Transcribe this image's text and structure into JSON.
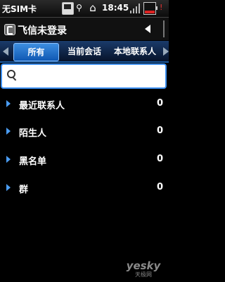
{
  "status_bar": {
    "sim_status": "无SIM卡",
    "time": "18:45",
    "icons": [
      "sd-card-icon",
      "usb-icon",
      "home-icon",
      "signal-icon",
      "battery-icon",
      "alert-icon"
    ]
  },
  "app": {
    "title": "飞信未登录"
  },
  "tabs": [
    {
      "label": "所有",
      "selected": true
    },
    {
      "label": "当前会话",
      "selected": false
    },
    {
      "label": "本地联系人",
      "selected": false
    }
  ],
  "search": {
    "value": "",
    "placeholder": ""
  },
  "groups": [
    {
      "label": "最近联系人",
      "count": "0"
    },
    {
      "label": "陌生人",
      "count": "0"
    },
    {
      "label": "黑名单",
      "count": "0"
    },
    {
      "label": "群",
      "count": "0"
    }
  ],
  "watermark": {
    "logo": "yesky",
    "subtitle": "天极网"
  },
  "colors": {
    "accent": "#1b5aa0",
    "tab_selected": "#2f7fd6",
    "search_border": "#3c8ff0",
    "chevron": "#4a9cf2"
  }
}
